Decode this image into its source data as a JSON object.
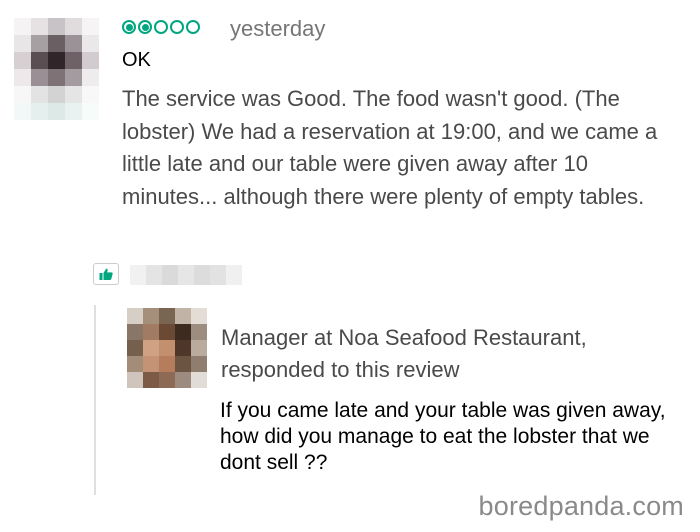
{
  "review": {
    "rating": 2,
    "rating_max": 5,
    "rating_color": "#00a680",
    "date": "yesterday",
    "title": "OK",
    "body": "The service was Good. The food wasn't good. (The lobster) We had a reservation at 19:00, and we came a little late and our table were given away after 10 minutes... although there were plenty of empty tables.",
    "helpful_icon": "thumbs-up-icon"
  },
  "response": {
    "responder": "Manager at Noa Seafood Restaurant, responded to this review",
    "body": "If you came late and your table was given away, how did you manage to eat the lobster that we dont sell ??"
  },
  "watermark": "boredpanda.com"
}
